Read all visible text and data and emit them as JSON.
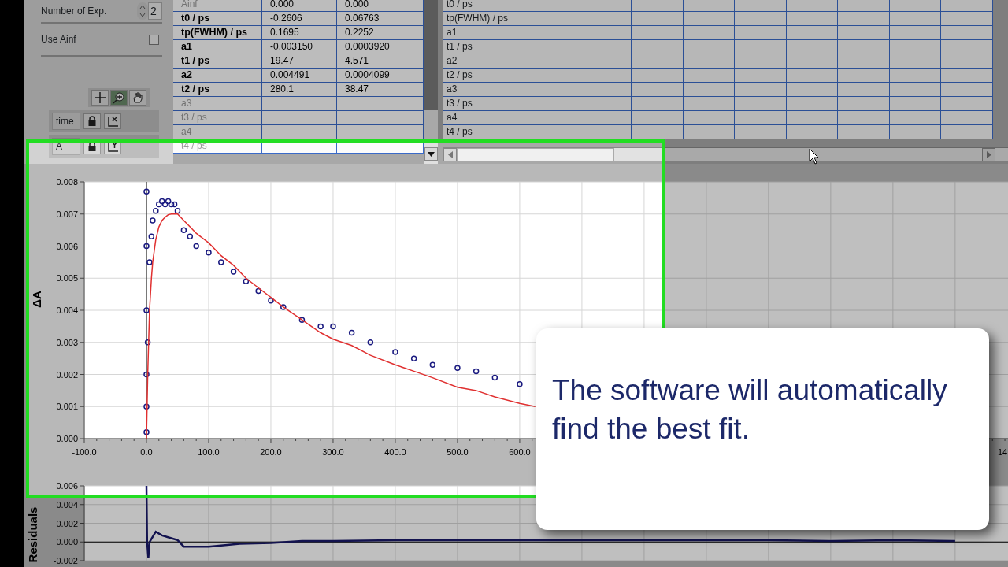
{
  "controls": {
    "number_of_exp": {
      "label": "Number of Exp.",
      "value": "2"
    },
    "use_ainf": {
      "label": "Use Ainf",
      "checked": false
    }
  },
  "scale_legend": [
    {
      "label": "time"
    },
    {
      "label": "A"
    }
  ],
  "fit_table": {
    "rows": [
      {
        "name": "Ainf",
        "enabled": false,
        "value": "0.000",
        "error": "0.000"
      },
      {
        "name": "t0 / ps",
        "enabled": true,
        "value": "-0.2606",
        "error": "0.06763"
      },
      {
        "name": "tp(FWHM) / ps",
        "enabled": true,
        "value": "0.1695",
        "error": "0.2252"
      },
      {
        "name": "a1",
        "enabled": true,
        "value": "-0.003150",
        "error": "0.0003920"
      },
      {
        "name": "t1 / ps",
        "enabled": true,
        "value": "19.47",
        "error": "4.571"
      },
      {
        "name": "a2",
        "enabled": true,
        "value": "0.004491",
        "error": "0.0004099"
      },
      {
        "name": "t2 / ps",
        "enabled": true,
        "value": "280.1",
        "error": "38.47"
      },
      {
        "name": "a3",
        "enabled": false
      },
      {
        "name": "t3 / ps",
        "enabled": false
      },
      {
        "name": "a4",
        "enabled": false
      },
      {
        "name": "t4 / ps",
        "enabled": false
      }
    ]
  },
  "results_table": {
    "rows": [
      "t0 / ps",
      "tp(FWHM) / ps",
      "a1",
      "t1 / ps",
      "a2",
      "t2 / ps",
      "a3",
      "t3 / ps",
      "a4",
      "t4 / ps"
    ]
  },
  "chart": {
    "edge_tick_label": "14",
    "chart_data": {
      "type": "scatter",
      "grid": true,
      "ylabel": "ΔA",
      "xlim": [
        -100,
        1385
      ],
      "ylim": [
        0,
        0.008
      ],
      "xticks": [
        {
          "value": -100,
          "label": "-100.0"
        },
        {
          "value": 0,
          "label": "0.0"
        },
        {
          "value": 100,
          "label": "100.0"
        },
        {
          "value": 200,
          "label": "200.0"
        },
        {
          "value": 300,
          "label": "300.0"
        },
        {
          "value": 400,
          "label": "400.0"
        },
        {
          "value": 500,
          "label": "500.0"
        },
        {
          "value": 600,
          "label": "600.0"
        }
      ],
      "yticks": [
        {
          "value": 0,
          "label": "0.000"
        },
        {
          "value": 0.001,
          "label": "0.001"
        },
        {
          "value": 0.002,
          "label": "0.002"
        },
        {
          "value": 0.003,
          "label": "0.003"
        },
        {
          "value": 0.004,
          "label": "0.004"
        },
        {
          "value": 0.005,
          "label": "0.005"
        },
        {
          "value": 0.006,
          "label": "0.006"
        },
        {
          "value": 0.007,
          "label": "0.007"
        },
        {
          "value": 0.008,
          "label": "0.008"
        }
      ],
      "x": [
        0,
        0,
        0,
        0,
        0,
        0,
        2,
        5,
        8,
        10,
        15,
        20,
        25,
        30,
        35,
        40,
        45,
        50,
        60,
        70,
        80,
        100,
        120,
        140,
        160,
        180,
        200,
        220,
        250,
        280,
        300,
        330,
        360,
        400,
        430,
        460,
        500,
        530,
        560,
        600,
        625
      ],
      "series": [
        {
          "type": "scatter",
          "color": "#1a1a80",
          "values": [
            0.0002,
            0.001,
            0.002,
            0.004,
            0.006,
            0.0077,
            0.003,
            0.0055,
            0.0063,
            0.0068,
            0.0071,
            0.0073,
            0.0074,
            0.0073,
            0.0074,
            0.0073,
            0.0073,
            0.0071,
            0.0065,
            0.0063,
            0.006,
            0.0058,
            0.0055,
            0.0052,
            0.0049,
            0.0046,
            0.0043,
            0.0041,
            0.0037,
            0.0035,
            0.0035,
            0.0033,
            0.003,
            0.0027,
            0.0025,
            0.0023,
            0.0022,
            0.0021,
            0.0019,
            0.0017,
            null
          ]
        },
        {
          "type": "line",
          "color": "#e03030",
          "values": [
            null,
            null,
            null,
            null,
            null,
            0,
            0.002,
            0.004,
            0.005,
            0.0055,
            0.0062,
            0.0066,
            0.0068,
            0.0069,
            0.00698,
            0.007,
            0.007,
            0.007,
            0.0068,
            0.0066,
            0.0064,
            0.0061,
            0.0057,
            0.0054,
            0.005,
            0.0047,
            0.0044,
            0.0041,
            0.0037,
            0.0033,
            0.0031,
            0.0029,
            0.0026,
            0.0023,
            0.0021,
            0.0019,
            0.0016,
            0.0015,
            0.0013,
            0.0011,
            0.001
          ]
        }
      ]
    }
  },
  "residuals": {
    "chart_data": {
      "type": "line",
      "grid": true,
      "ylabel": "Residuals",
      "xlim": [
        -100,
        1385
      ],
      "ylim": [
        -0.002,
        0.006
      ],
      "yticks": [
        {
          "value": -0.002,
          "label": "-0.002"
        },
        {
          "value": 0,
          "label": "0.000"
        },
        {
          "value": 0.002,
          "label": "0.002"
        },
        {
          "value": 0.004,
          "label": "0.004"
        },
        {
          "value": 0.006,
          "label": "0.006"
        }
      ],
      "x": [
        0,
        1,
        3,
        5,
        15,
        25,
        40,
        50,
        60,
        100,
        150,
        200,
        250,
        300,
        400,
        500,
        600,
        700,
        800,
        900,
        1000,
        1100,
        1200,
        1300
      ],
      "series": [
        {
          "color": "#1a1a6a",
          "values": [
            0.006,
            0.0,
            -0.0017,
            0.0,
            0.0011,
            0.0007,
            0.0004,
            0.0002,
            -0.0005,
            -0.0005,
            -0.0002,
            -0.0001,
            0.0001,
            0.0001,
            0.0002,
            0.0002,
            0.0002,
            0.0002,
            0.0002,
            0.0002,
            0.0002,
            0.0001,
            0.0002,
            0.0001
          ]
        }
      ]
    }
  },
  "callout": {
    "text": "The software will automatically find the best fit."
  }
}
